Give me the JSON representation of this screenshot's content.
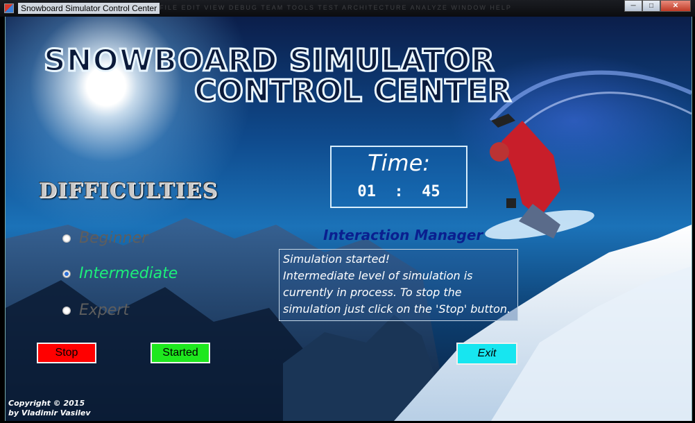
{
  "window": {
    "title": "Snowboard Simulator Control Center",
    "faded_menu": "FILE  EDIT  VIEW  DEBUG  TEAM  TOOLS  TEST  ARCHITECTURE  ANALYZE  WINDOW  HELP",
    "minimize_symbol": "─",
    "maximize_symbol": "□",
    "close_symbol": "✕"
  },
  "logo": {
    "line1": "SNOWBOARD SIMULATOR",
    "line2": "CONTROL CENTER"
  },
  "timer": {
    "label": "Time:",
    "value": "01  :  45"
  },
  "difficulties": {
    "title": "DIFFICULTIES",
    "options": [
      {
        "label": "Beginner",
        "selected": false,
        "color": "#5e5e5e"
      },
      {
        "label": "Intermediate",
        "selected": true,
        "color": "#1cf07a"
      },
      {
        "label": "Expert",
        "selected": false,
        "color": "#5e5e5e"
      }
    ]
  },
  "interaction_manager": {
    "title": "Interaction Manager",
    "lines": [
      "Simulation started!",
      "Intermediate level of simulation is",
      "currently in process. To stop the",
      "simulation just click on the 'Stop' button."
    ]
  },
  "buttons": {
    "stop": "Stop",
    "started": "Started",
    "exit": "Exit"
  },
  "copyright": {
    "line1": "Copyright © 2015",
    "line2": "by Vladimir Vasilev"
  },
  "colors": {
    "stop": "#ff0000",
    "started": "#1ee81e",
    "exit": "#17e6f0",
    "im_title": "#0a1f8f"
  }
}
